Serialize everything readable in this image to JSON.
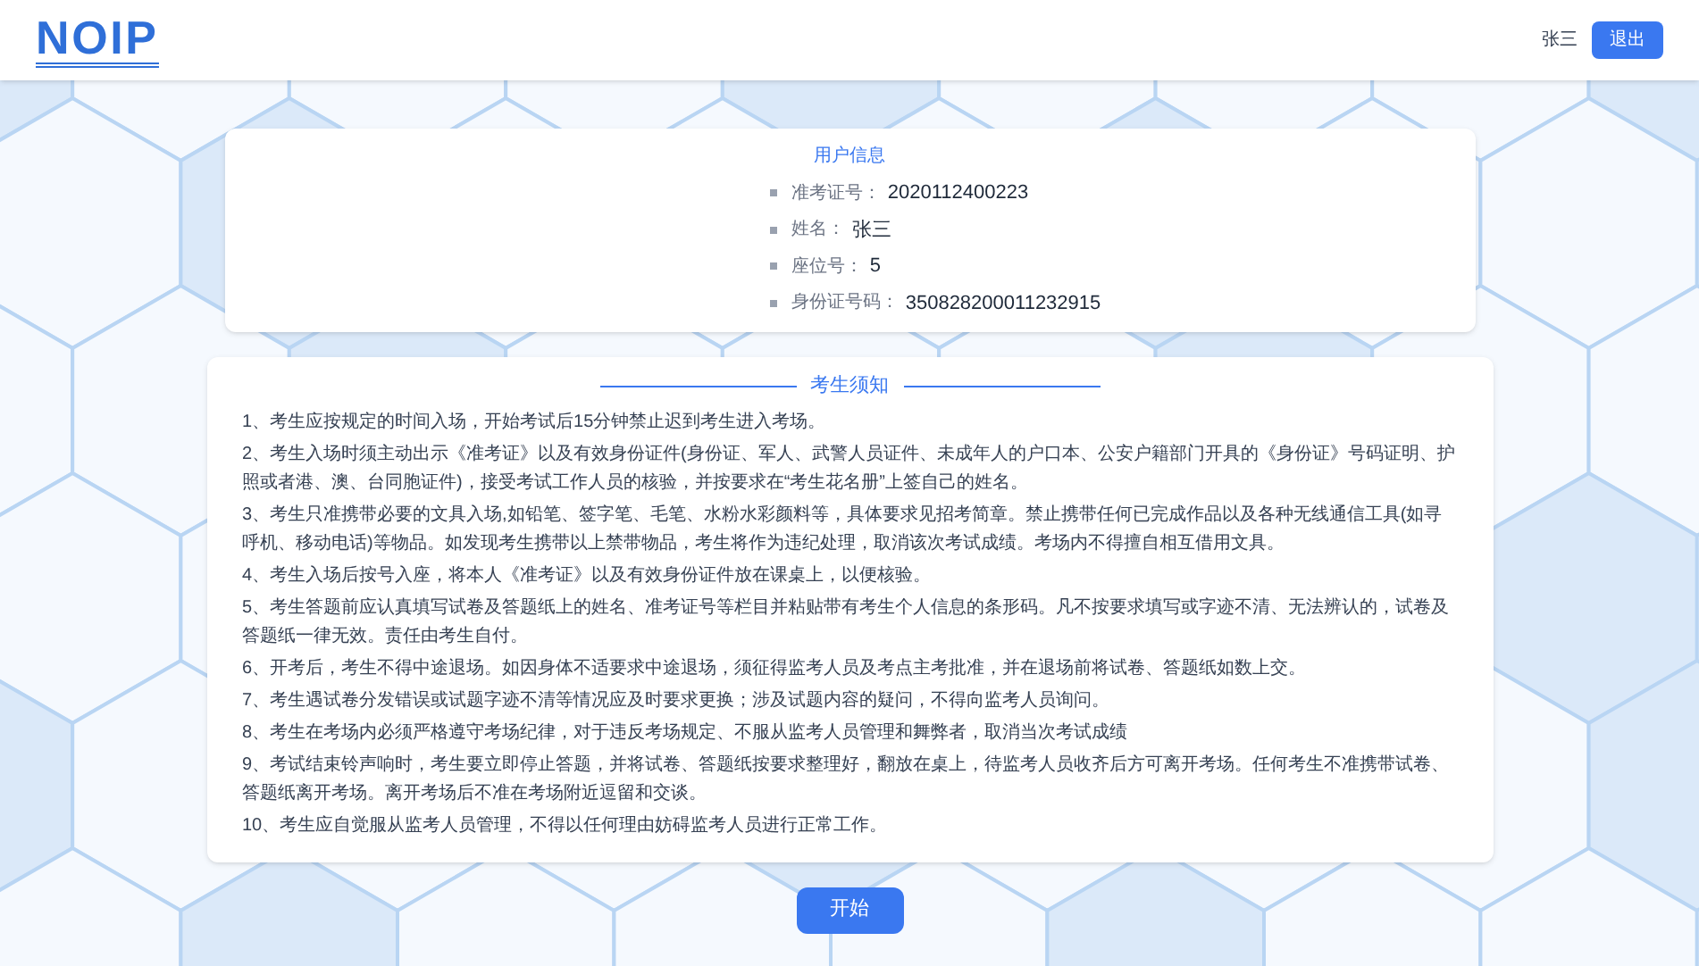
{
  "header": {
    "logo": "NOIP",
    "user_name": "张三",
    "logout_button": "退出"
  },
  "user_info": {
    "title": "用户信息",
    "fields": [
      {
        "label": "准考证号：",
        "value": "2020112400223"
      },
      {
        "label": "姓名：",
        "value": "张三"
      },
      {
        "label": "座位号：",
        "value": "5"
      },
      {
        "label": "身份证号码：",
        "value": "350828200011232915"
      }
    ]
  },
  "notice": {
    "title": "考生须知",
    "items": [
      "1、考生应按规定的时间入场，开始考试后15分钟禁止迟到考生进入考场。",
      "2、考生入场时须主动出示《准考证》以及有效身份证件(身份证、军人、武警人员证件、未成年人的户口本、公安户籍部门开具的《身份证》号码证明、护照或者港、澳、台同胞证件)，接受考试工作人员的核验，并按要求在“考生花名册”上签自己的姓名。",
      "3、考生只准携带必要的文具入场,如铅笔、签字笔、毛笔、水粉水彩颜料等，具体要求见招考简章。禁止携带任何已完成作品以及各种无线通信工具(如寻呼机、移动电话)等物品。如发现考生携带以上禁带物品，考生将作为违纪处理，取消该次考试成绩。考场内不得擅自相互借用文具。",
      "4、考生入场后按号入座，将本人《准考证》以及有效身份证件放在课桌上，以便核验。",
      "5、考生答题前应认真填写试卷及答题纸上的姓名、准考证号等栏目并粘贴带有考生个人信息的条形码。凡不按要求填写或字迹不清、无法辨认的，试卷及答题纸一律无效。责任由考生自付。",
      "6、开考后，考生不得中途退场。如因身体不适要求中途退场，须征得监考人员及考点主考批准，并在退场前将试卷、答题纸如数上交。",
      "7、考生遇试卷分发错误或试题字迹不清等情况应及时要求更换；涉及试题内容的疑问，不得向监考人员询问。",
      "8、考生在考场内必须严格遵守考场纪律，对于违反考场规定、不服从监考人员管理和舞弊者，取消当次考试成绩",
      "9、考试结束铃声响时，考生要立即停止答题，并将试卷、答题纸按要求整理好，翻放在桌上，待监考人员收齐后方可离开考场。任何考生不准携带试卷、答题纸离开考场。离开考场后不准在考场附近逗留和交谈。",
      "10、考生应自觉服从监考人员管理，不得以任何理由妨碍监考人员进行正常工作。"
    ]
  },
  "start_button": "开始"
}
